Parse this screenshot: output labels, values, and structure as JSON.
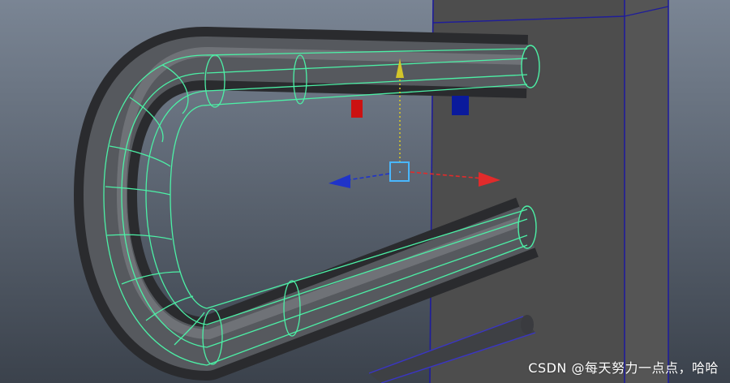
{
  "viewport": {
    "background_top": "#7a8594",
    "background_bottom": "#3b424c",
    "wireframe_color": "#4cf0a6",
    "object_color": "#3f4145",
    "panel_color": "#505050",
    "panel_edge_color": "#1f1d9a"
  },
  "manipulator": {
    "x_axis_color": "#e12b2b",
    "y_axis_color": "#d3c52a",
    "z_axis_color": "#1f33c9",
    "center_color": "#49b7ff",
    "x_handle_color": "#cc1111",
    "z_handle_color": "#0a1a9c"
  },
  "icons": [
    "translate-manipulator-icon",
    "x-axis-arrow-icon",
    "y-axis-arrow-icon",
    "z-axis-arrow-icon"
  ],
  "watermark": "CSDN @每天努力一点点，哈哈"
}
